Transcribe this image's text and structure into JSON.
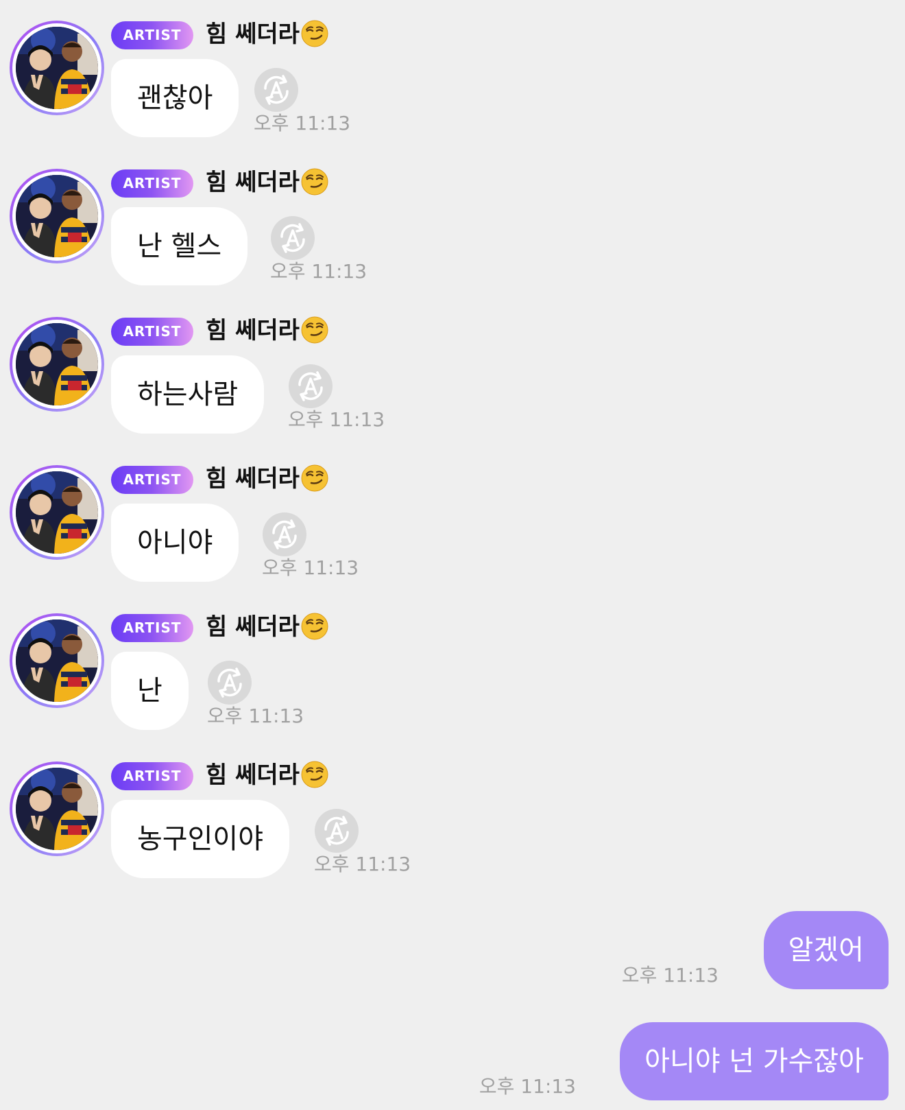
{
  "colors": {
    "background": "#efefef",
    "incoming_bubble": "#ffffff",
    "outgoing_bubble": "#a488f6",
    "badge_gradient": [
      "#6a3cf5",
      "#e197f2"
    ],
    "timestamp": "#a0a0a0"
  },
  "incoming": [
    {
      "badge": "ARTIST",
      "sender": "힘 쎄더라",
      "sender_emoji": "smirking-face-emoji",
      "text": "괜찮아",
      "time": "오후 11:13",
      "icon": "auto-translate-icon"
    },
    {
      "badge": "ARTIST",
      "sender": "힘 쎄더라",
      "sender_emoji": "smirking-face-emoji",
      "text": "난 헬스",
      "time": "오후 11:13",
      "icon": "auto-translate-icon"
    },
    {
      "badge": "ARTIST",
      "sender": "힘 쎄더라",
      "sender_emoji": "smirking-face-emoji",
      "text": "하는사람",
      "time": "오후 11:13",
      "icon": "auto-translate-icon"
    },
    {
      "badge": "ARTIST",
      "sender": "힘 쎄더라",
      "sender_emoji": "smirking-face-emoji",
      "text": "아니야",
      "time": "오후 11:13",
      "icon": "auto-translate-icon"
    },
    {
      "badge": "ARTIST",
      "sender": "힘 쎄더라",
      "sender_emoji": "smirking-face-emoji",
      "text": "난",
      "time": "오후 11:13",
      "icon": "auto-translate-icon"
    },
    {
      "badge": "ARTIST",
      "sender": "힘 쎄더라",
      "sender_emoji": "smirking-face-emoji",
      "text": "농구인이야",
      "time": "오후 11:13",
      "icon": "auto-translate-icon"
    }
  ],
  "outgoing": [
    {
      "text": "알겠어",
      "time": "오후 11:13"
    },
    {
      "text": "아니야 넌 가수잖아",
      "time": "오후 11:13"
    }
  ]
}
